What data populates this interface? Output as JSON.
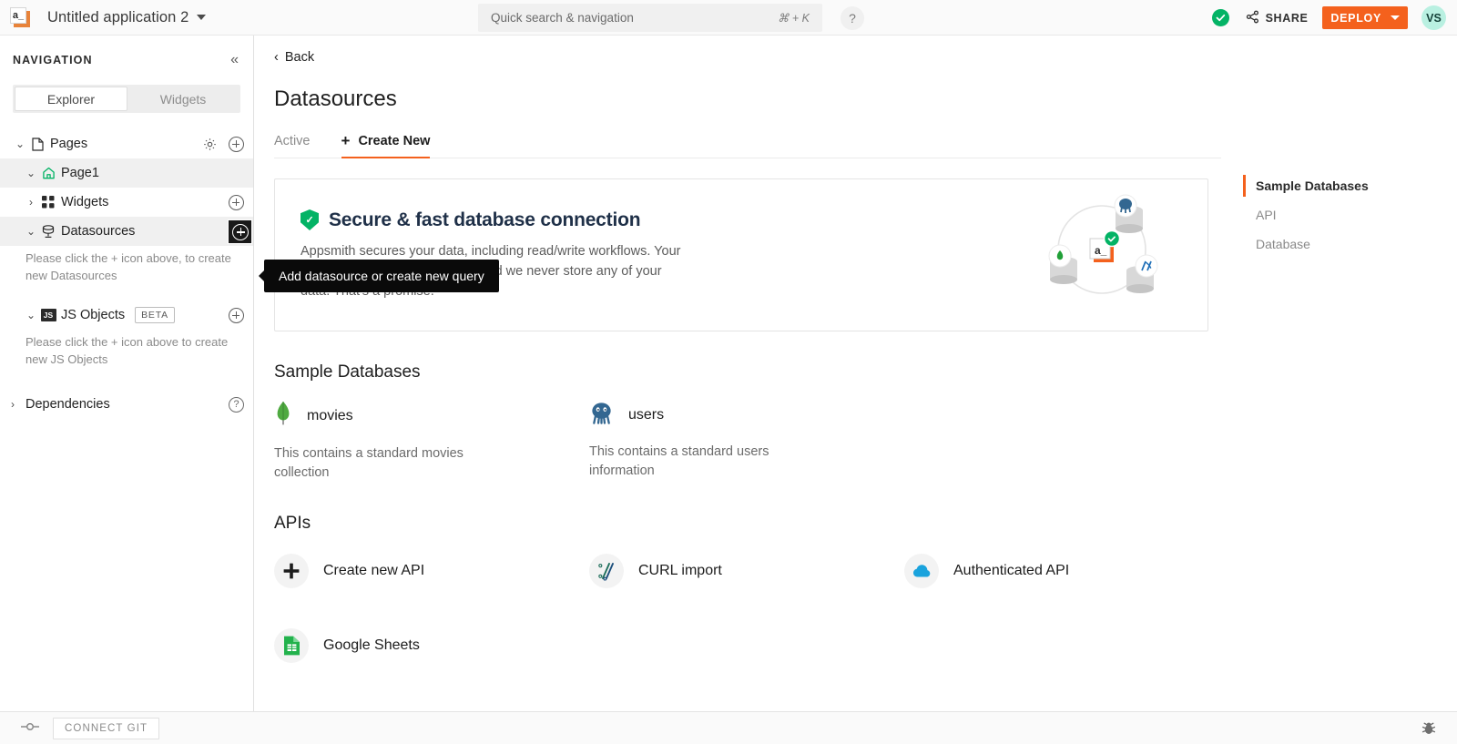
{
  "topbar": {
    "app_logo_text": "a_",
    "app_title": "Untitled application 2",
    "caret_icon": "chevron-down-icon",
    "search": {
      "placeholder": "Quick search & navigation",
      "shortcut": "⌘ + K"
    },
    "help_label": "?",
    "status_icon": "check-circle-icon",
    "share_label": "SHARE",
    "deploy_label": "DEPLOY",
    "avatar_initials": "VS"
  },
  "sidebar": {
    "title": "NAVIGATION",
    "collapse_icon": "collapse-left-icon",
    "tabs": [
      {
        "label": "Explorer",
        "active": true
      },
      {
        "label": "Widgets",
        "active": false
      }
    ],
    "tree": [
      {
        "label": "Pages",
        "icon": "page-icon",
        "chevron": "expanded",
        "actions": [
          "gear-icon",
          "plus-icon"
        ]
      },
      {
        "label": "Page1",
        "icon": "home-icon",
        "chevron": "expanded",
        "selected": true
      },
      {
        "label": "Widgets",
        "icon": "widgets-grid-icon",
        "chevron": "collapsed",
        "actions": [
          "plus-icon"
        ]
      },
      {
        "label": "Datasources",
        "icon": "datasource-icon",
        "chevron": "expanded",
        "selected": true,
        "actions": [
          "plus-icon-highlighted"
        ]
      },
      {
        "label": "JS Objects",
        "icon": "js-icon",
        "chevron": "expanded",
        "badge": "BETA",
        "actions": [
          "plus-icon"
        ]
      },
      {
        "label": "Dependencies",
        "icon": "none",
        "chevron": "collapsed",
        "actions": [
          "help-icon"
        ]
      }
    ],
    "hint_datasources": "Please click the + icon above, to create new Datasources",
    "hint_jsobjects": "Please click the + icon above to create new JS Objects"
  },
  "tooltip": {
    "text": "Add datasource or create new query"
  },
  "main": {
    "back_label": "Back",
    "page_title": "Datasources",
    "tabs": [
      {
        "label": "Active",
        "active": false,
        "icon": "none"
      },
      {
        "label": "Create New",
        "active": true,
        "icon": "plus-icon"
      }
    ],
    "promo": {
      "heading": "Secure & fast database connection",
      "shield_icon": "shield-check-icon",
      "body": "Appsmith secures your data, including read/write workflows. Your Passwords are fully encrypted and we never store any of your data. That's a promise.",
      "art_icon": "database-network-illustration"
    },
    "sample_databases_title": "Sample Databases",
    "sample_databases": [
      {
        "name": "movies",
        "icon": "mongodb-leaf-icon",
        "description": "This contains a standard movies collection"
      },
      {
        "name": "users",
        "icon": "postgresql-elephant-icon",
        "description": "This contains a standard users information"
      }
    ],
    "apis_title": "APIs",
    "apis": [
      {
        "label": "Create new API",
        "icon": "plus-icon"
      },
      {
        "label": "CURL import",
        "icon": "curl-icon"
      },
      {
        "label": "Authenticated API",
        "icon": "authenticated-api-icon"
      },
      {
        "label": "Google Sheets",
        "icon": "google-sheets-icon"
      }
    ],
    "right_nav": [
      {
        "label": "Sample Databases",
        "active": true
      },
      {
        "label": "API",
        "active": false
      },
      {
        "label": "Database",
        "active": false
      }
    ]
  },
  "bottombar": {
    "git_icon": "git-branch-icon",
    "connect_git_label": "CONNECT GIT",
    "debug_icon": "bug-icon"
  },
  "colors": {
    "accent_orange": "#f4611d",
    "success_green": "#03b365",
    "avatar_bg": "#b9f0e1",
    "mongodb_green": "#4faa41",
    "postgres_blue": "#336791",
    "sheets_green": "#22b24c",
    "auth_api_blue": "#1aa3dd"
  }
}
